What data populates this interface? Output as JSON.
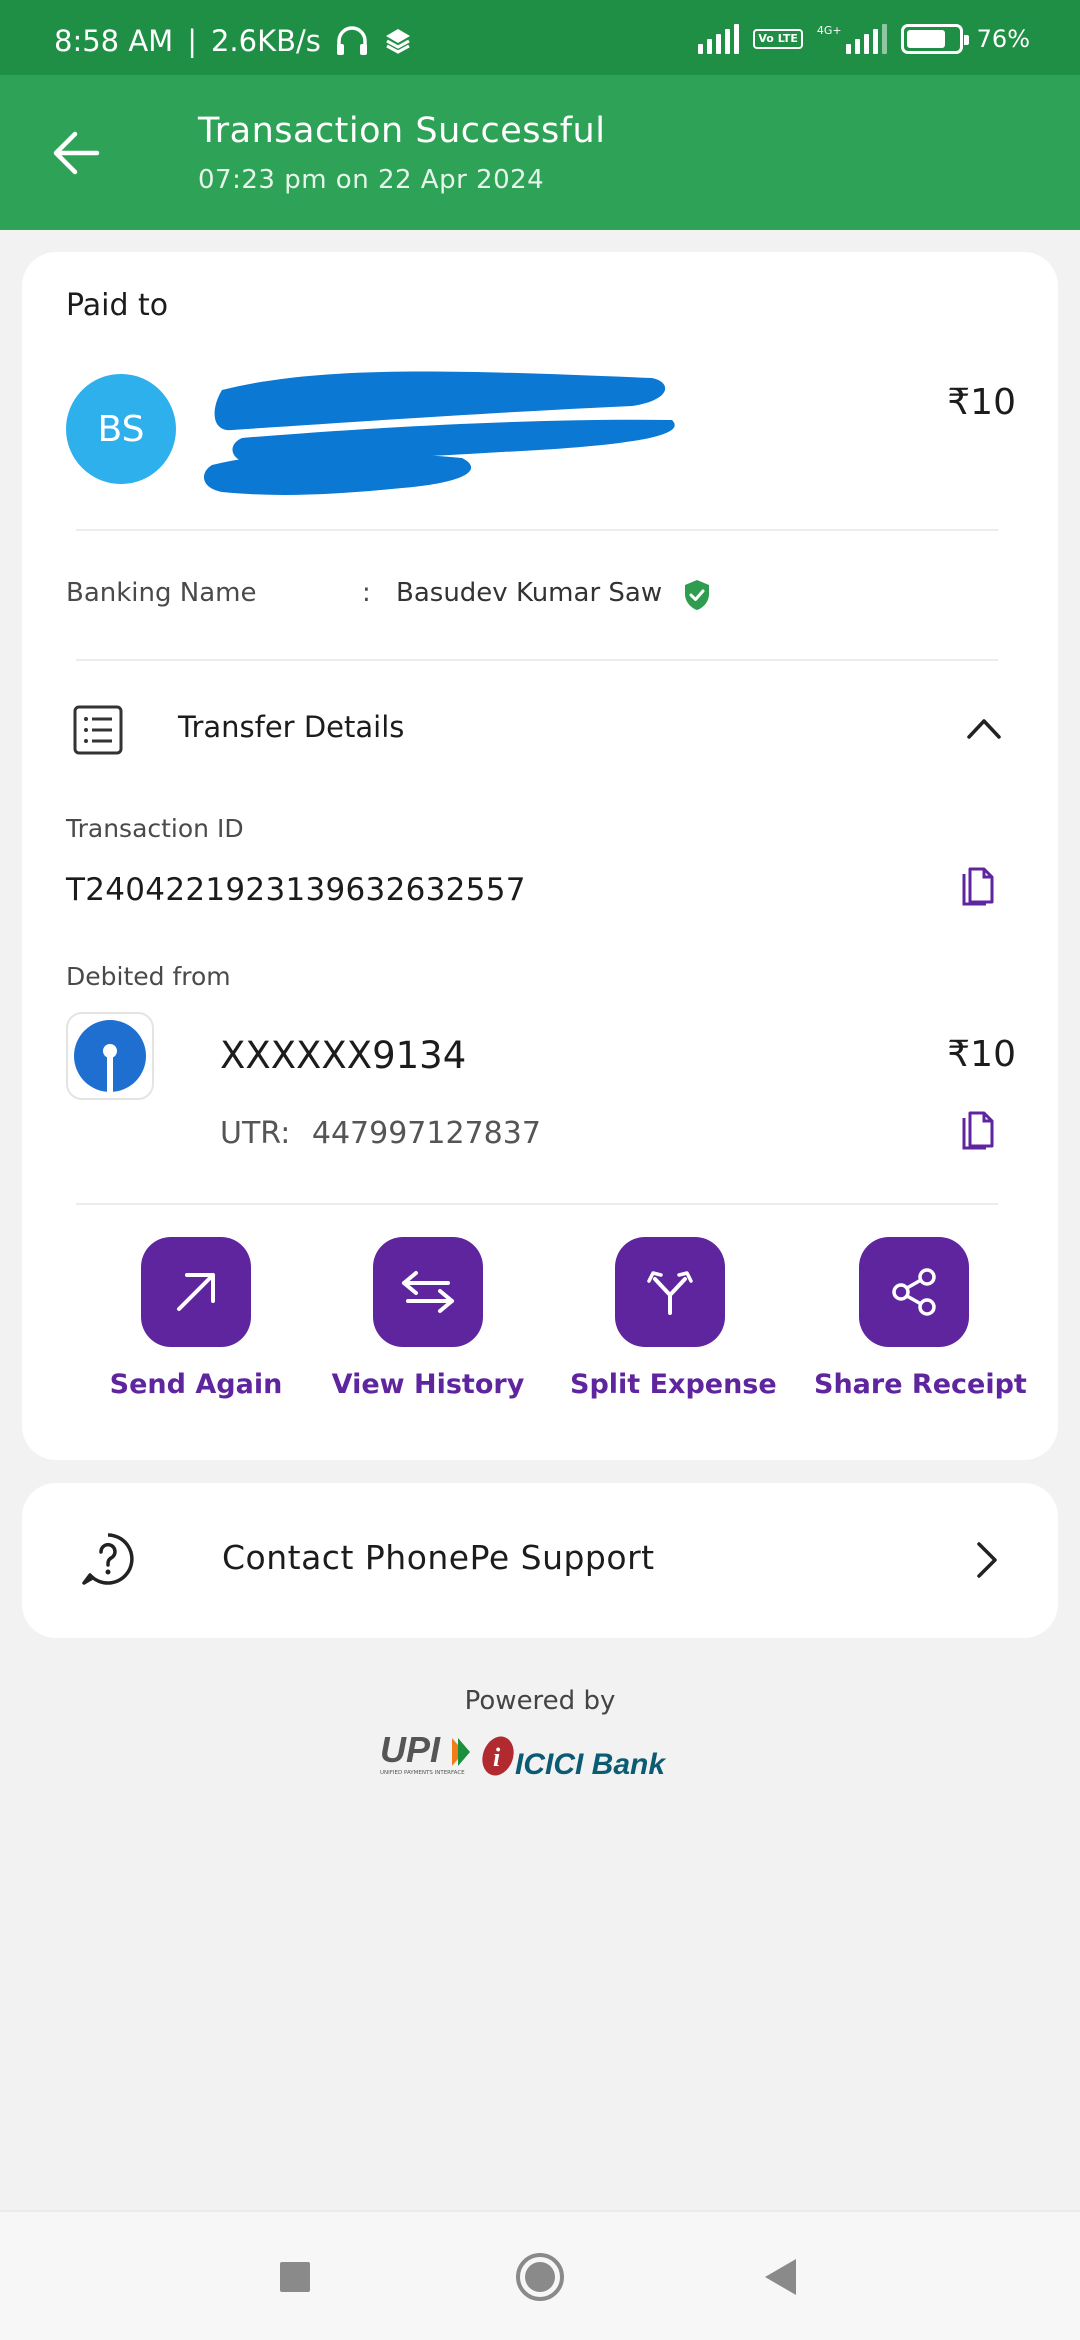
{
  "status_bar": {
    "time": "8:58 AM",
    "separator": "|",
    "speed": "2.6KB/s",
    "volte": "Vo LTE",
    "network": "4G+",
    "battery": "76%"
  },
  "header": {
    "title": "Transaction Successful",
    "subtitle": "07:23 pm on 22 Apr 2024",
    "background": "#2ea357"
  },
  "payee": {
    "section_label": "Paid to",
    "initials": "BS",
    "amount": "₹10",
    "banking_name_label": "Banking Name",
    "colon": ":",
    "banking_name": "Basudev Kumar Saw"
  },
  "transfer_details": {
    "title": "Transfer Details",
    "transaction_id_label": "Transaction ID",
    "transaction_id": "T2404221923139632632557",
    "debited_from_label": "Debited from",
    "account": "XXXXXX9134",
    "amount": "₹10",
    "utr_label": "UTR:",
    "utr": "447997127837"
  },
  "actions": [
    {
      "label": "Send Again",
      "icon": "arrow-up-right-icon"
    },
    {
      "label": "View History",
      "icon": "swap-arrows-icon"
    },
    {
      "label": "Split Expense",
      "icon": "split-icon"
    },
    {
      "label": "Share Receipt",
      "icon": "share-icon"
    }
  ],
  "support": {
    "label": "Contact PhonePe Support"
  },
  "footer": {
    "powered_by": "Powered by",
    "upi_logo_text": "UPI",
    "upi_tagline": "UNIFIED PAYMENTS INTERFACE",
    "bank_logo_text": "ICICI Bank"
  },
  "colors": {
    "accent": "#5f259f",
    "success": "#2ea357",
    "avatar": "#2eb0ec",
    "verified": "#2e9d4f"
  }
}
